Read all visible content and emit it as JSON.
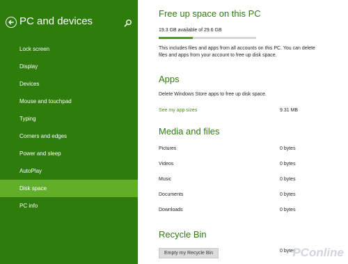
{
  "sidebar": {
    "title": "PC and devices",
    "items": [
      {
        "label": "Lock screen"
      },
      {
        "label": "Display"
      },
      {
        "label": "Devices"
      },
      {
        "label": "Mouse and touchpad"
      },
      {
        "label": "Typing"
      },
      {
        "label": "Corners and edges"
      },
      {
        "label": "Power and sleep"
      },
      {
        "label": "AutoPlay"
      },
      {
        "label": "Disk space",
        "active": true
      },
      {
        "label": "PC info"
      }
    ]
  },
  "free_space": {
    "title": "Free up space on this PC",
    "storage_text": "19.3 GB available of 29.6 GB",
    "used_fraction": 0.35,
    "description": "This includes files and apps from all accounts on this PC. You can delete files and apps from your account to free up disk space."
  },
  "apps": {
    "title": "Apps",
    "description": "Delete Windows Store apps to free up disk space.",
    "link_label": "See my app sizes",
    "size": "9.31 MB"
  },
  "media": {
    "title": "Media and files",
    "rows": [
      {
        "label": "Pictures",
        "value": "0 bytes"
      },
      {
        "label": "Videos",
        "value": "0 bytes"
      },
      {
        "label": "Music",
        "value": "0 bytes"
      },
      {
        "label": "Documents",
        "value": "0 bytes"
      },
      {
        "label": "Downloads",
        "value": "0 bytes"
      }
    ]
  },
  "recycle": {
    "title": "Recycle Bin",
    "value": "0 bytes",
    "button_label": "Empty my Recycle Bin"
  },
  "watermark": "PConline",
  "colors": {
    "sidebar_bg": "#2d7c0c",
    "sidebar_active": "#61ae29",
    "accent": "#2d7c0c",
    "progress_fill": "#4a9a1e"
  }
}
